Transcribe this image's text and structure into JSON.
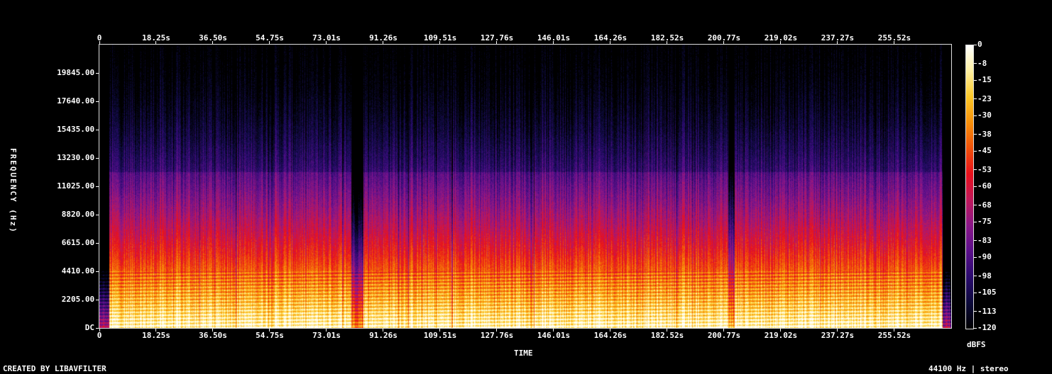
{
  "chart_data": {
    "type": "heatmap",
    "xlabel": "TIME",
    "ylabel": "FREQUENCY (Hz)",
    "colorbar_label": "dBFS",
    "x_ticks": [
      "0",
      "18.25s",
      "36.50s",
      "54.75s",
      "73.01s",
      "91.26s",
      "109.51s",
      "127.76s",
      "146.01s",
      "164.26s",
      "182.52s",
      "200.77s",
      "219.02s",
      "237.27s",
      "255.52s"
    ],
    "x_tick_values": [
      0,
      18.25,
      36.5,
      54.75,
      73.01,
      91.26,
      109.51,
      127.76,
      146.01,
      164.26,
      182.52,
      200.77,
      219.02,
      237.27,
      255.52
    ],
    "xlim": [
      0,
      273.8
    ],
    "y_ticks": [
      "DC",
      "2205.00",
      "4410.00",
      "6615.00",
      "8820.00",
      "11025.00",
      "13230.00",
      "15435.00",
      "17640.00",
      "19845.00"
    ],
    "y_tick_values": [
      0,
      2205,
      4410,
      6615,
      8820,
      11025,
      13230,
      15435,
      17640,
      19845
    ],
    "ylim": [
      0,
      22050
    ],
    "colorbar_ticks": [
      "0",
      "-8",
      "-15",
      "-23",
      "-30",
      "-38",
      "-45",
      "-53",
      "-60",
      "-68",
      "-75",
      "-83",
      "-90",
      "-98",
      "-105",
      "-113",
      "-120"
    ],
    "colorbar_values": [
      0,
      -8,
      -15,
      -23,
      -30,
      -38,
      -45,
      -53,
      -60,
      -68,
      -75,
      -83,
      -90,
      -98,
      -105,
      -113,
      -120
    ],
    "colorbar_range": [
      -120,
      0
    ],
    "colormap": [
      "#000000",
      "#0c0a3a",
      "#2a0b6e",
      "#5a0f8a",
      "#8a1788",
      "#c0185a",
      "#e8101c",
      "#f0500a",
      "#f8900a",
      "#fcc828",
      "#fff0a0",
      "#ffffff"
    ],
    "grid": false
  },
  "footer": {
    "left": "CREATED BY LIBAVFILTER",
    "right": "44100 Hz | stereo"
  }
}
